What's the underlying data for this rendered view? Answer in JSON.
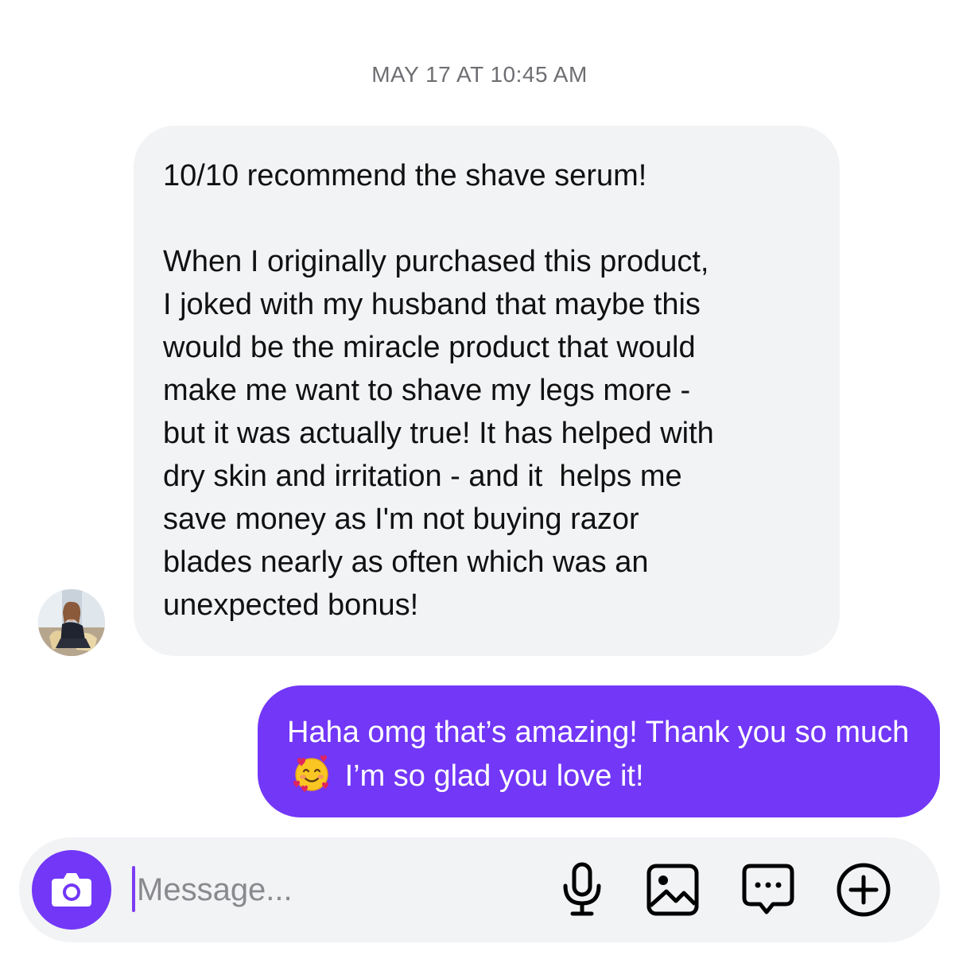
{
  "thread": {
    "timestamp": "MAY 17 AT 10:45 AM"
  },
  "incoming_message": {
    "line_1": "10/10 recommend the shave serum!",
    "body": "When I originally purchased this product,\nI joked with my husband that maybe this\nwould be the miracle product that would\nmake me want to shave my legs more -\nbut it was actually true! It has helped with\ndry skin and irritation - and it  helps me\nsave money as I'm not buying razor\nblades nearly as often which was an\nunexpected bonus!"
  },
  "outgoing_message": {
    "before_emoji": "Haha omg that’s amazing! Thank you so much",
    "emoji_name": "smiling-face-with-hearts",
    "after_emoji": "I’m so glad you love it!"
  },
  "composer": {
    "placeholder": "Message...",
    "buttons": [
      {
        "icon": "camera-icon"
      },
      {
        "icon": "microphone-icon"
      },
      {
        "icon": "gallery-icon"
      },
      {
        "icon": "sticker-chat-icon"
      },
      {
        "icon": "plus-circle-icon"
      }
    ]
  },
  "colors": {
    "accent": "#7237f7",
    "incoming_bubble": "#f2f3f5",
    "timestamp_text": "#6e6e73"
  }
}
